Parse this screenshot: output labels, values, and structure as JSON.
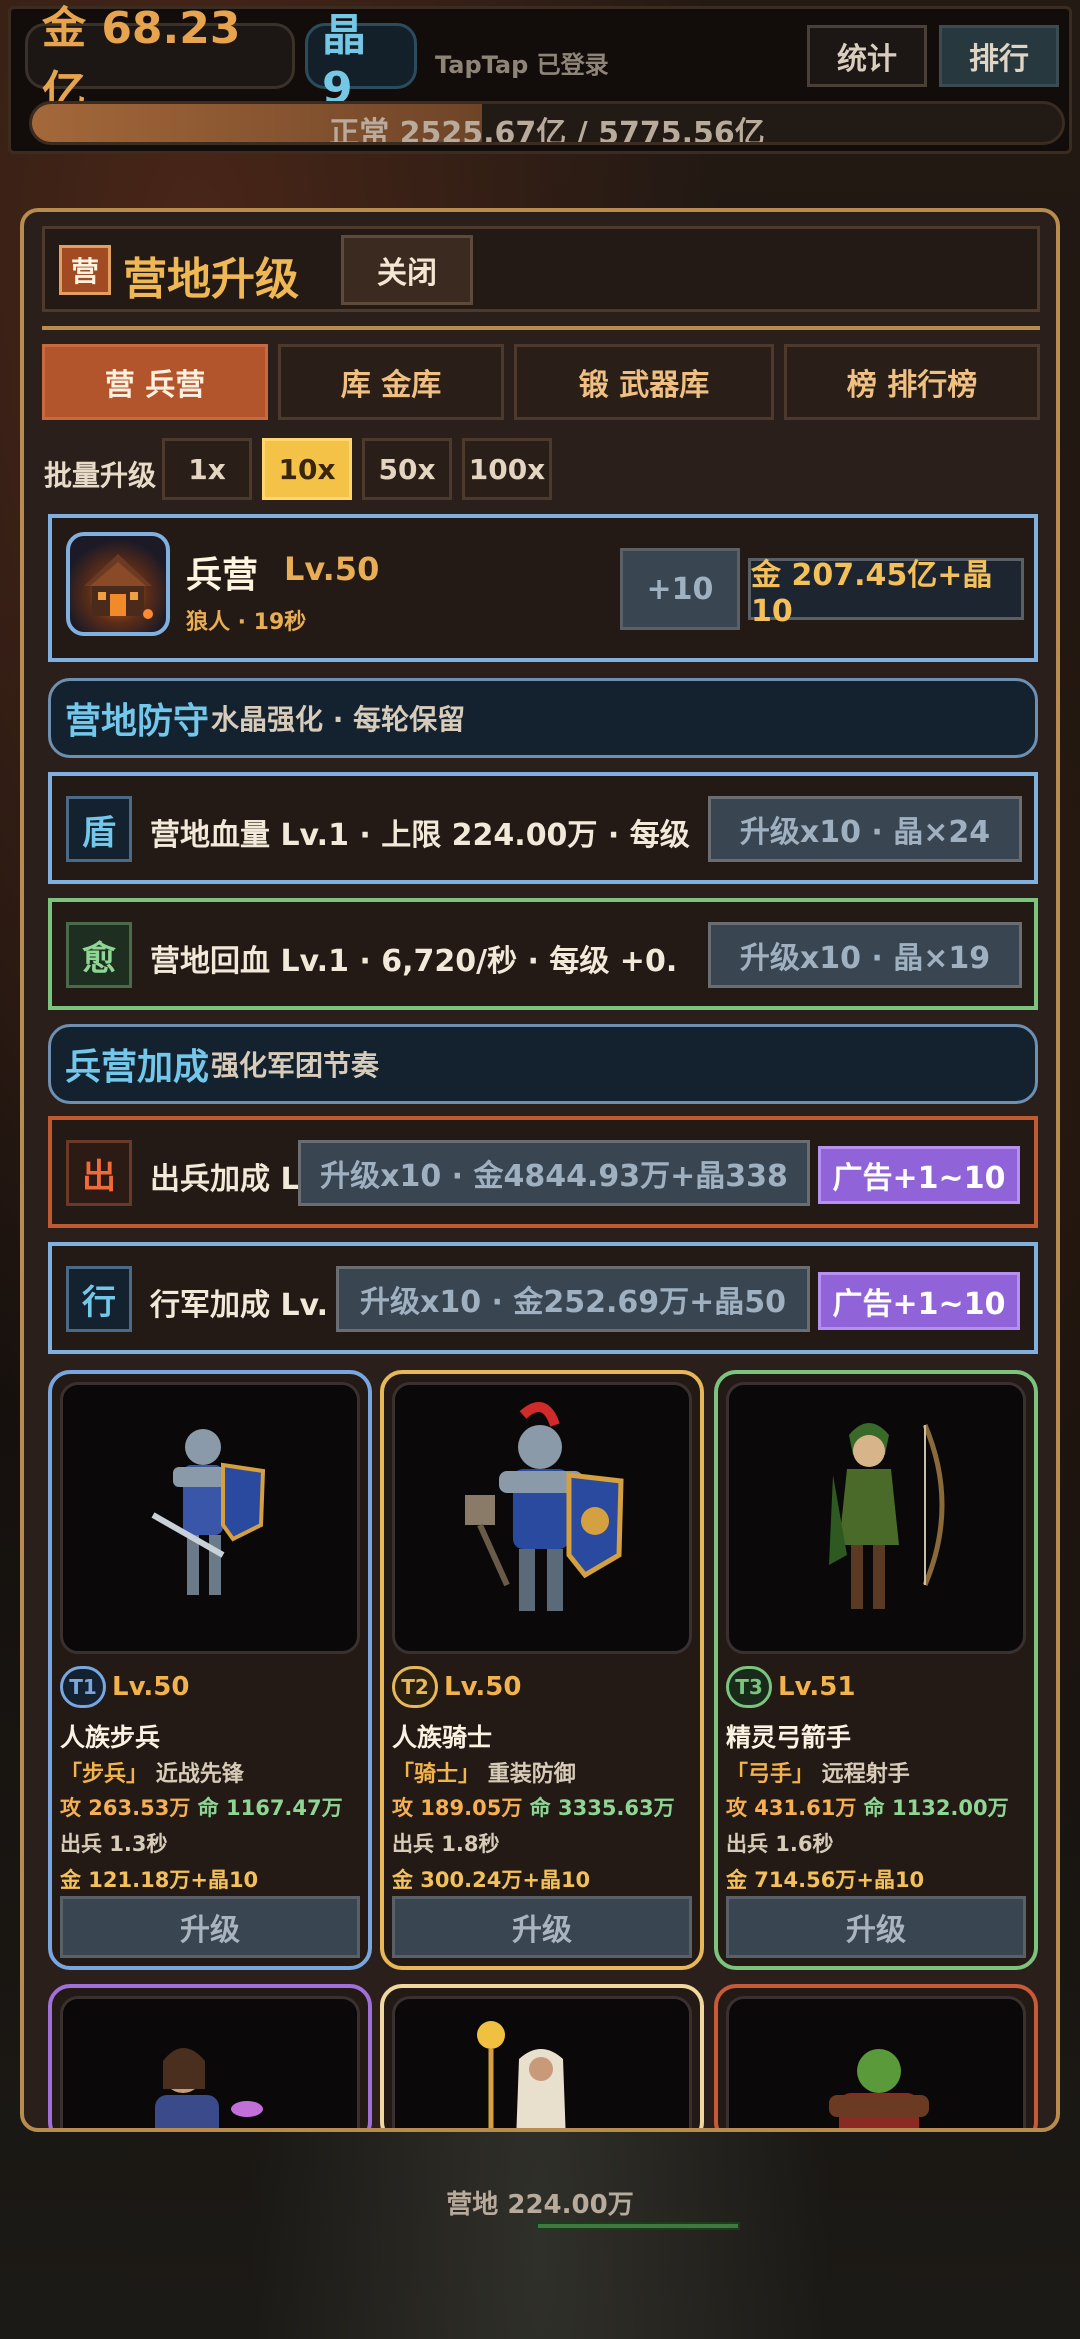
{
  "topbar": {
    "gold": "金 68.23亿",
    "crystal": "晶 9",
    "login_status": "TapTap 已登录",
    "stats_btn": "统计",
    "rank_btn": "排行",
    "progress_text": "正常 2525.67亿 / 5775.56亿",
    "progress": 0.437
  },
  "panel": {
    "icon": "营",
    "title": "营地升级",
    "close": "关闭",
    "tabs": [
      {
        "label": "营 兵营",
        "active": true
      },
      {
        "label": "库 金库",
        "active": false
      },
      {
        "label": "锻 武器库",
        "active": false
      },
      {
        "label": "榜 排行榜",
        "active": false
      }
    ],
    "batch_label": "批量升级",
    "batch_options": [
      "1x",
      "10x",
      "50x",
      "100x"
    ],
    "batch_selected": "10x",
    "barracks": {
      "name": "兵营",
      "level": "Lv.50",
      "sub": "狼人 · 19秒",
      "plus_btn": "+10",
      "cost_btn": "金 207.45亿+晶10"
    },
    "defense": {
      "title": "营地防守",
      "sub": "水晶强化 · 每轮保留"
    },
    "hp_row": {
      "icon": "盾",
      "text": "营地血量 Lv.1 · 上限 224.00万 · 每级",
      "upgrade": "升级x10 · 晶×24"
    },
    "regen_row": {
      "icon": "愈",
      "text": "营地回血 Lv.1 · 6,720/秒 · 每级 +0.",
      "upgrade": "升级x10 · 晶×19"
    },
    "bonus": {
      "title": "兵营加成",
      "sub": "强化军团节奏"
    },
    "deploy_row": {
      "icon": "出",
      "text": "出兵加成 L",
      "upgrade": "升级x10 · 金4844.93万+晶338",
      "ad": "广告+1~10"
    },
    "march_row": {
      "icon": "行",
      "text": "行军加成 Lv.",
      "upgrade": "升级x10 · 金252.69万+晶50",
      "ad": "广告+1~10"
    },
    "units": [
      {
        "tier": "T1",
        "level": "Lv.50",
        "name": "人族步兵",
        "tag": "「步兵」",
        "role": "近战先锋",
        "atk": "攻 263.53万",
        "hp": "命 1167.47万",
        "deploy": "出兵 1.3秒",
        "cost": "金 121.18万+晶10",
        "btn": "升级",
        "color": "#7aa6e0"
      },
      {
        "tier": "T2",
        "level": "Lv.50",
        "name": "人族骑士",
        "tag": "「骑士」",
        "role": "重装防御",
        "atk": "攻 189.05万",
        "hp": "命 3335.63万",
        "deploy": "出兵 1.8秒",
        "cost": "金 300.24万+晶10",
        "btn": "升级",
        "color": "#e8b75a"
      },
      {
        "tier": "T3",
        "level": "Lv.51",
        "name": "精灵弓箭手",
        "tag": "「弓手」",
        "role": "远程射手",
        "atk": "攻 431.61万",
        "hp": "命 1132.00万",
        "deploy": "出兵 1.6秒",
        "cost": "金 714.56万+晶10",
        "btn": "升级",
        "color": "#7cc47e"
      }
    ],
    "units_row2_colors": [
      "#a070d8",
      "#f0d8a0",
      "#c85a3a"
    ]
  },
  "bottom": {
    "camp_label": "营地 224.00万"
  }
}
